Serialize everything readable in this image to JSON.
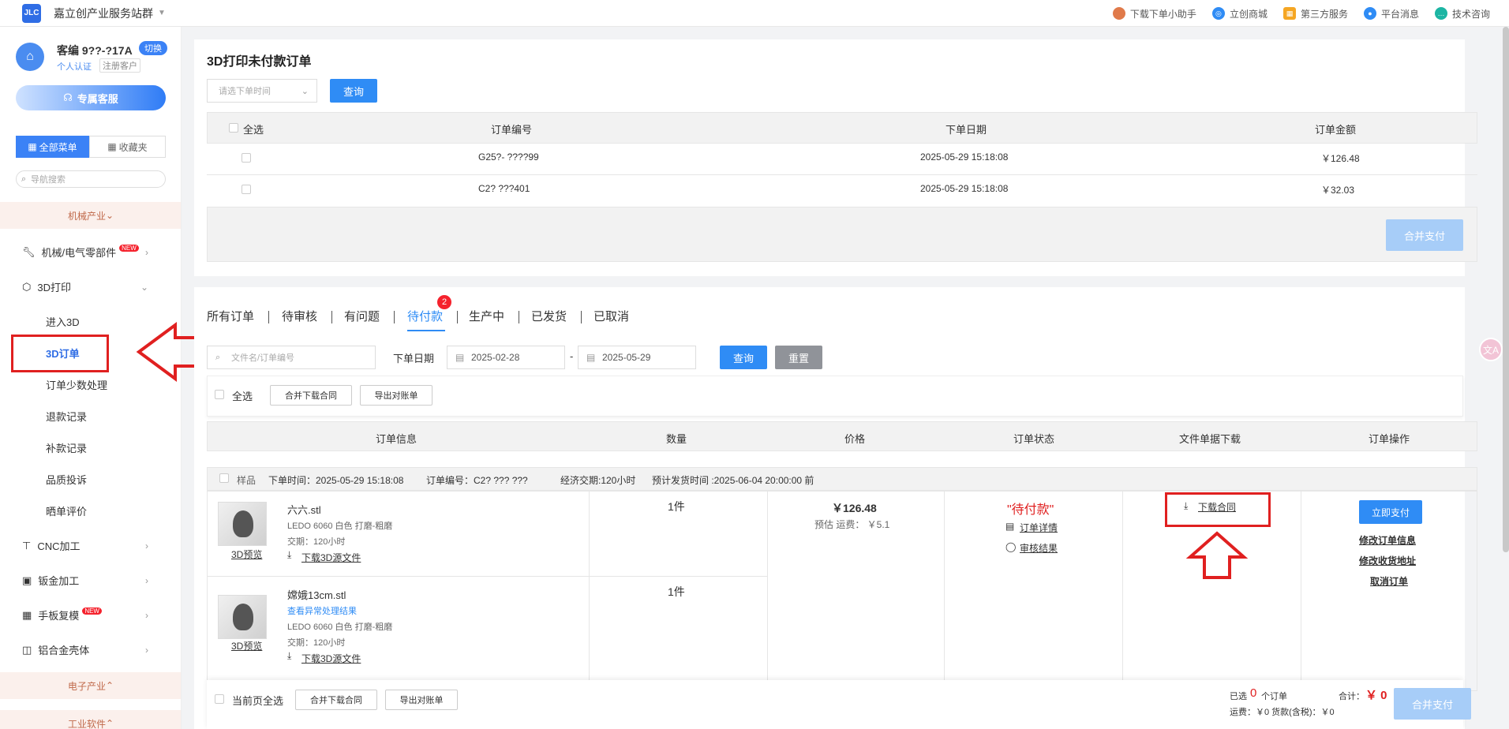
{
  "topbar": {
    "site_name": "嘉立创产业服务站群",
    "links": [
      "下载下单小助手",
      "立创商城",
      "第三方服务",
      "平台消息",
      "技术咨询"
    ]
  },
  "sidebar": {
    "customer_no": "客编 9??-?17A",
    "switch": "切换",
    "verify": "个人认证",
    "reg_tag": "注册客户",
    "service": "专属客服",
    "all_menu": "全部菜单",
    "favorites": "收藏夹",
    "search_placeholder": "导航搜索",
    "section_mech": "机械产业",
    "items": {
      "mech_parts": "机械/电气零部件",
      "print3d": "3D打印",
      "enter3d": "进入3D",
      "orders3d": "3D订单",
      "order_small": "订单少数处理",
      "refund": "退款记录",
      "supplement": "补款记录",
      "quality": "品质投诉",
      "review": "晒单评价",
      "cnc": "CNC加工",
      "sheet": "钣金加工",
      "handboard": "手板复模",
      "alu": "铝合金壳体"
    },
    "new": "NEW",
    "section_elec": "电子产业",
    "section_soft": "工业软件"
  },
  "unpaid": {
    "title": "3D打印未付款订单",
    "time_placeholder": "请选下单时间",
    "query": "查询",
    "headers": [
      "全选",
      "订单编号",
      "下单日期",
      "订单金额"
    ],
    "rows": [
      {
        "no": "G25?- ????99",
        "date": "2025-05-29 15:18:08",
        "amount": "￥126.48"
      },
      {
        "no": "C2? ???401",
        "date": "2025-05-29 15:18:08",
        "amount": "￥32.03"
      }
    ],
    "merge_pay": "合并支付"
  },
  "orders": {
    "tabs": [
      "所有订单",
      "待审核",
      "有问题",
      "待付款",
      "生产中",
      "已发货",
      "已取消"
    ],
    "badge": "2",
    "search_placeholder": "文件名/订单编号",
    "date_label": "下单日期",
    "date_from": "2025-02-28",
    "date_to": "2025-05-29",
    "query": "查询",
    "reset": "重置",
    "select_all": "全选",
    "merge_download": "合并下载合同",
    "export": "导出对账单",
    "headers": [
      "订单信息",
      "数量",
      "价格",
      "订单状态",
      "文件单据下载",
      "订单操作"
    ],
    "group": {
      "tag": "样品",
      "time": "下单时间：2025-05-29 15:18:08",
      "no": "订单编号：C2? ??? ???",
      "delivery": "经济交期:120小时",
      "ship": "预计发货时间 :2025-06-04 20:00:00 前"
    },
    "items": [
      {
        "name": "六六.stl",
        "spec": "LEDO 6060  白色 打磨-粗磨",
        "lead": "交期：120小时",
        "preview": "3D预览",
        "download": "下载3D源文件",
        "qty": "1件",
        "abnormal": ""
      },
      {
        "name": "嫦娥13cm.stl",
        "spec": "LEDO 6060  白色 打磨-粗磨",
        "lead": "交期：120小时",
        "preview": "3D预览",
        "download": "下载3D源文件",
        "qty": "1件",
        "abnormal": "查看异常处理结果"
      }
    ],
    "price": "￥126.48",
    "shipping": "预估 运费：  ￥5.1",
    "status": "\"待付款\"",
    "detail": "订单详情",
    "audit": "审核结果",
    "contract": "下载合同",
    "pay_now": "立即支付",
    "modify_info": "修改订单信息",
    "modify_addr": "修改收货地址",
    "cancel": "取消订单",
    "footer": {
      "page_all": "当前页全选",
      "merge_download": "合并下载合同",
      "export": "导出对账单",
      "selected_pre": "已选",
      "selected_count": "0",
      "selected_post": "个订单",
      "fee": "运费：￥0   货款(含税)：￥0",
      "total_label": "合计：",
      "total": "￥ 0",
      "merge_pay": "合并支付"
    }
  }
}
